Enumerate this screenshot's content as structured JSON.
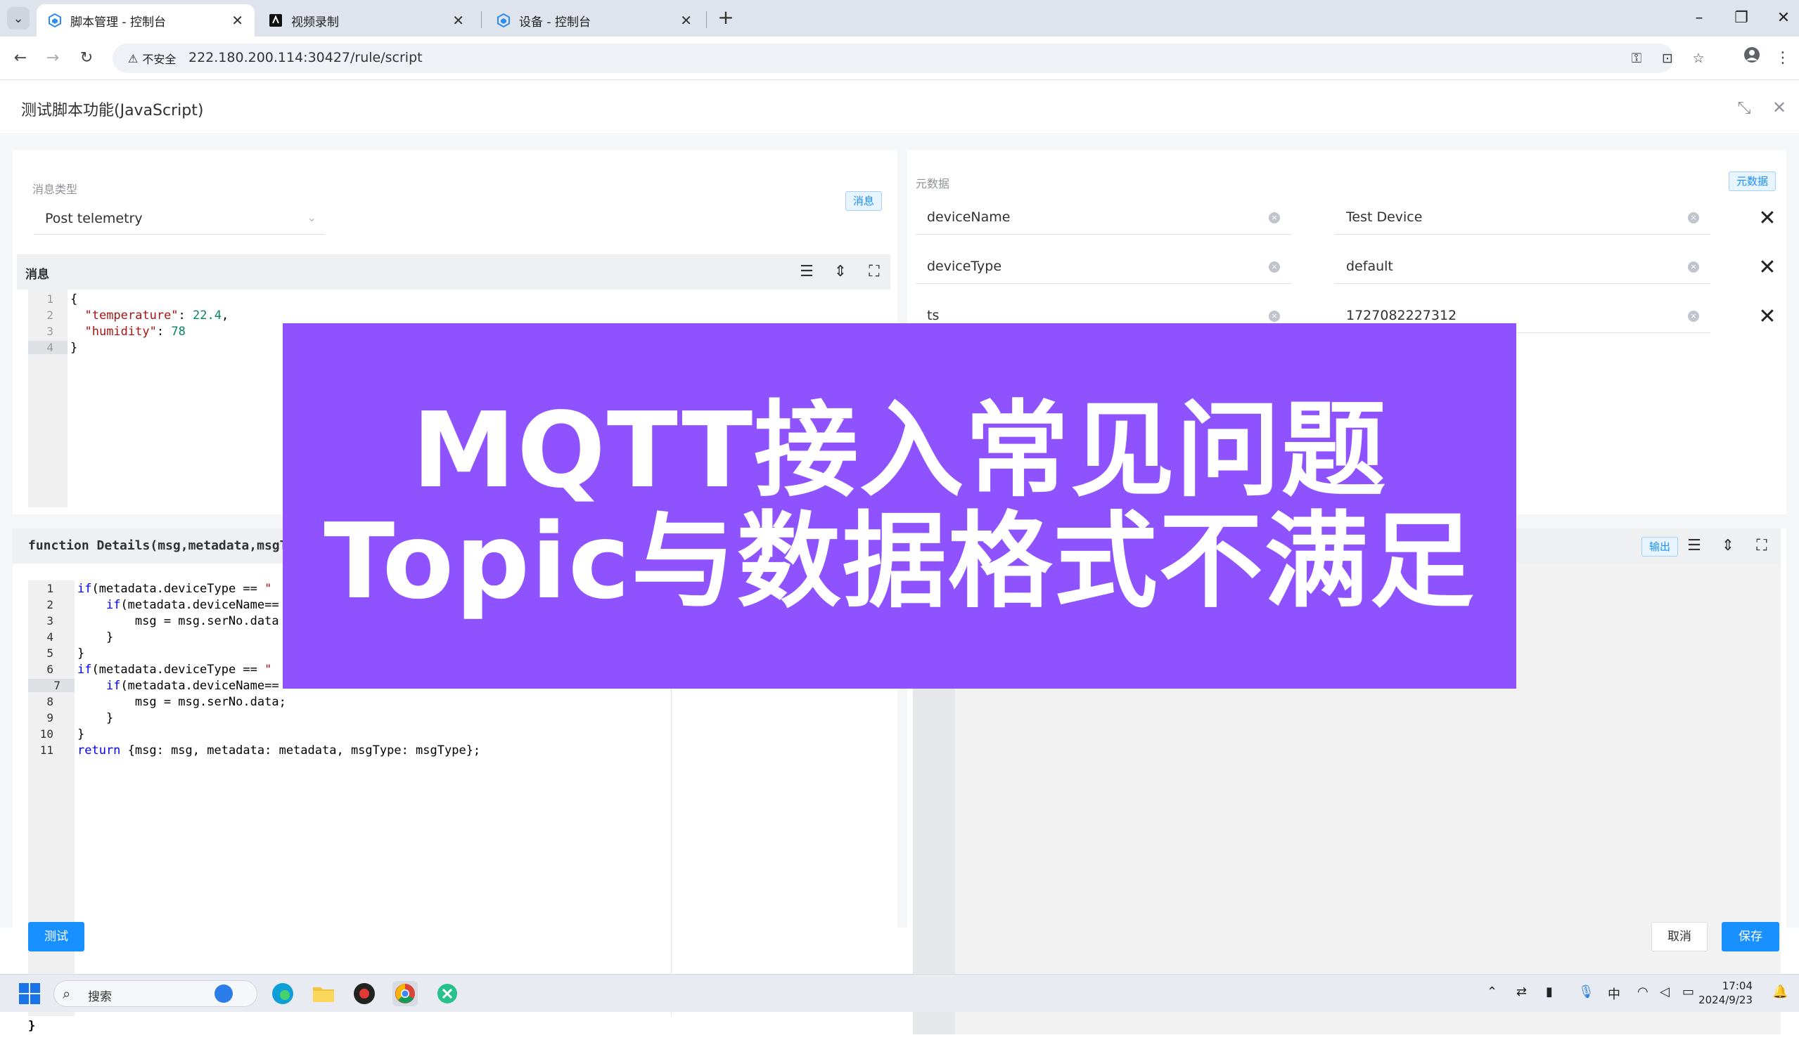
{
  "browser": {
    "tabs": [
      {
        "title": "脚本管理 - 控制台",
        "active": true,
        "icon": "cube-icon"
      },
      {
        "title": "视频录制",
        "active": false,
        "icon": "black-square-icon"
      },
      {
        "title": "设备 - 控制台",
        "active": false,
        "icon": "cube-icon"
      }
    ],
    "security_label": "不安全",
    "url": "222.180.200.114:30427/rule/script"
  },
  "dialog": {
    "title": "测试脚本功能(JavaScript)"
  },
  "message_panel": {
    "type_label": "消息类型",
    "type_value": "Post telemetry",
    "chip": "消息",
    "editor_label": "消息",
    "line_numbers": [
      "1",
      "2",
      "3",
      "4"
    ]
  },
  "metadata_panel": {
    "label": "元数据",
    "chip": "元数据",
    "rows": [
      {
        "key": "deviceName",
        "value": "Test Device"
      },
      {
        "key": "deviceType",
        "value": "default"
      },
      {
        "key": "ts",
        "value": "1727082227312"
      }
    ]
  },
  "function_panel": {
    "header": "function Details(msg,metadata,msgTy",
    "line_numbers": [
      "1",
      "2",
      "3",
      "4",
      "5",
      "6",
      "7",
      "8",
      "9",
      "10",
      "11"
    ],
    "closing_brace": "}"
  },
  "output_panel": {
    "chip": "输出"
  },
  "footer": {
    "test_button": "测试",
    "cancel_button": "取消",
    "save_button": "保存"
  },
  "overlay": {
    "line1": "MQTT接入常见问题",
    "line2": "Topic与数据格式不满足"
  },
  "taskbar": {
    "search_placeholder": "搜索",
    "ime": "中",
    "time": "17:04",
    "date": "2024/9/23"
  }
}
